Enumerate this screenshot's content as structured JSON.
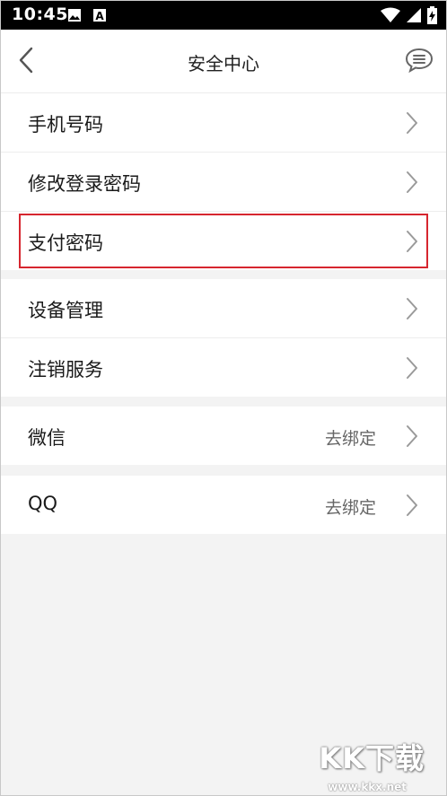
{
  "status_bar": {
    "time": "10:45",
    "icons": [
      "image-icon",
      "a-notification-icon",
      "wifi-icon",
      "signal-icon",
      "battery-charging-icon"
    ]
  },
  "header": {
    "title": "安全中心",
    "back_icon": "chevron-left-icon",
    "right_icon": "message-icon"
  },
  "groups": [
    {
      "rows": [
        {
          "label": "手机号码",
          "value": ""
        },
        {
          "label": "修改登录密码",
          "value": ""
        },
        {
          "label": "支付密码",
          "value": "",
          "highlighted": true
        }
      ]
    },
    {
      "rows": [
        {
          "label": "设备管理",
          "value": ""
        },
        {
          "label": "注销服务",
          "value": ""
        }
      ]
    },
    {
      "rows": [
        {
          "label": "微信",
          "value": "去绑定"
        }
      ]
    },
    {
      "rows": [
        {
          "label": "QQ",
          "value": "去绑定"
        }
      ]
    }
  ],
  "watermark": {
    "brand": "KK下载",
    "url": "www.kkx.net"
  },
  "colors": {
    "background": "#f3f3f3",
    "highlight_border": "#d6262f",
    "chevron": "#9a9a9a"
  }
}
